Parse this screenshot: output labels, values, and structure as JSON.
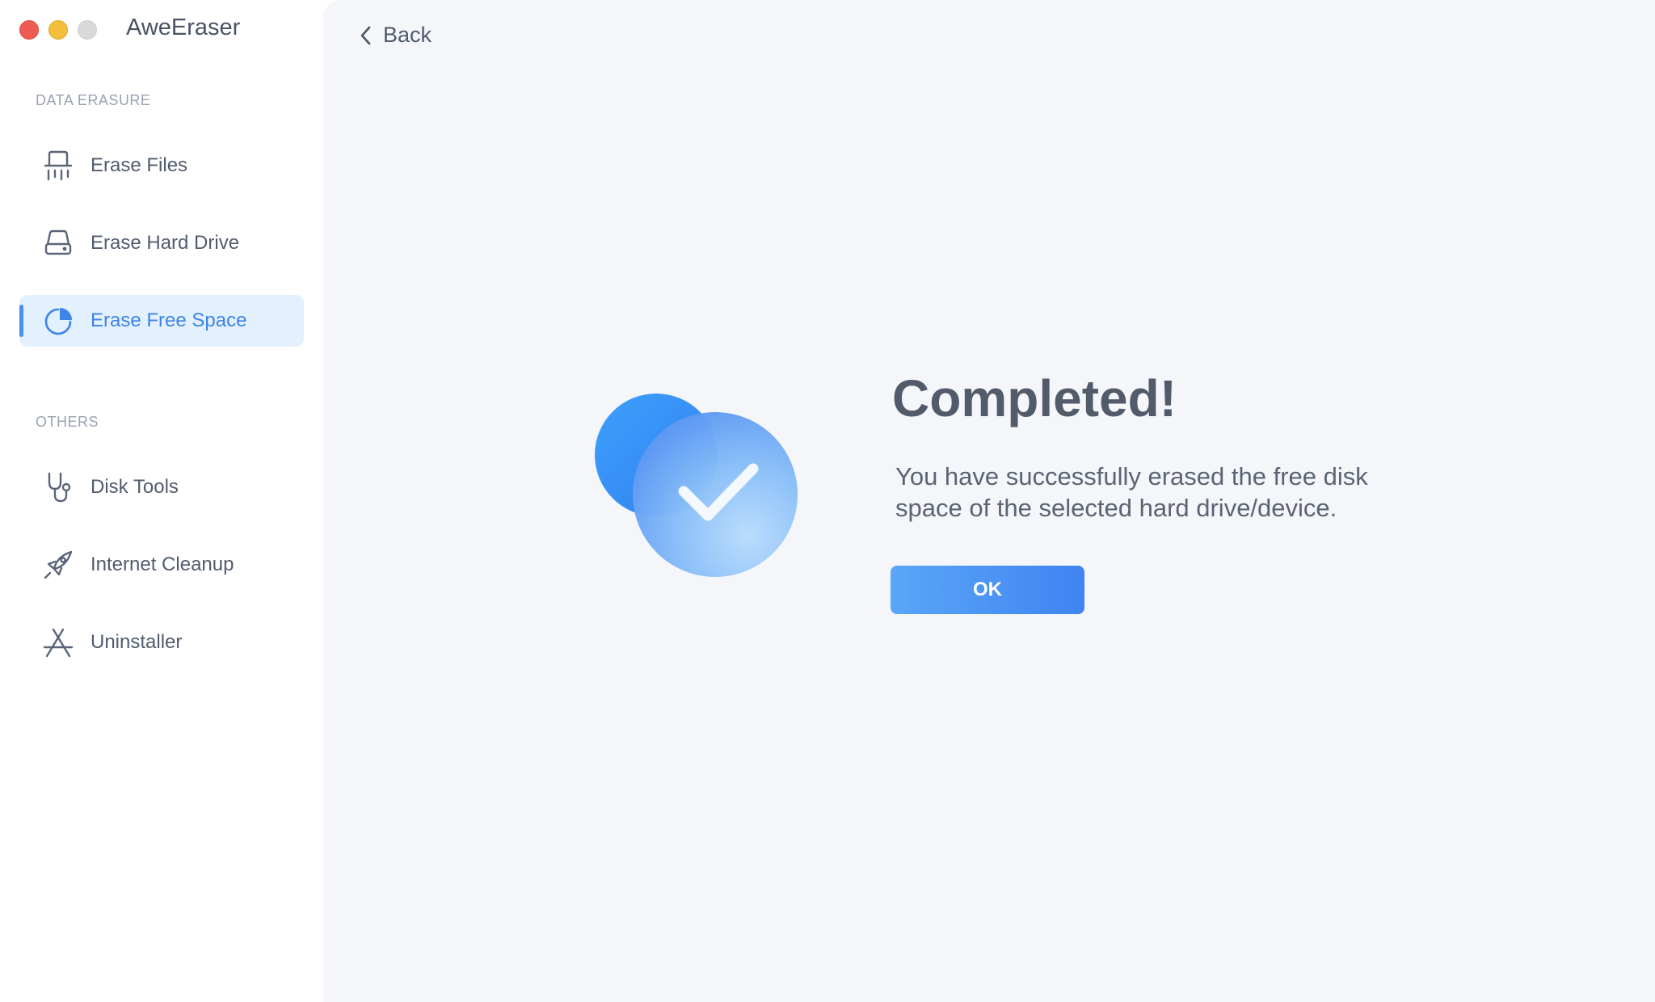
{
  "window": {
    "title": "AweEraser",
    "controls": [
      "close",
      "minimize",
      "maximize"
    ]
  },
  "sidebar": {
    "sections": [
      {
        "heading": "DATA ERASURE",
        "items": [
          {
            "label": "Erase Files",
            "icon": "shredder-icon",
            "active": false
          },
          {
            "label": "Erase Hard Drive",
            "icon": "hard-drive-icon",
            "active": false
          },
          {
            "label": "Erase Free Space",
            "icon": "pie-chart-icon",
            "active": true
          }
        ]
      },
      {
        "heading": "OTHERS",
        "items": [
          {
            "label": "Disk Tools",
            "icon": "stethoscope-icon",
            "active": false
          },
          {
            "label": "Internet Cleanup",
            "icon": "rocket-icon",
            "active": false
          },
          {
            "label": "Uninstaller",
            "icon": "app-store-icon",
            "active": false
          }
        ]
      }
    ]
  },
  "main": {
    "back_label": "Back",
    "result": {
      "title": "Completed!",
      "message": "You have successfully erased the free disk space of the selected hard drive/device.",
      "ok_label": "OK",
      "icon": "success-check-icon"
    }
  },
  "colors": {
    "accent": "#4a8fef",
    "active_bg": "#e3f0fd",
    "main_bg": "#f5f6fa",
    "text": "#525b6a"
  }
}
